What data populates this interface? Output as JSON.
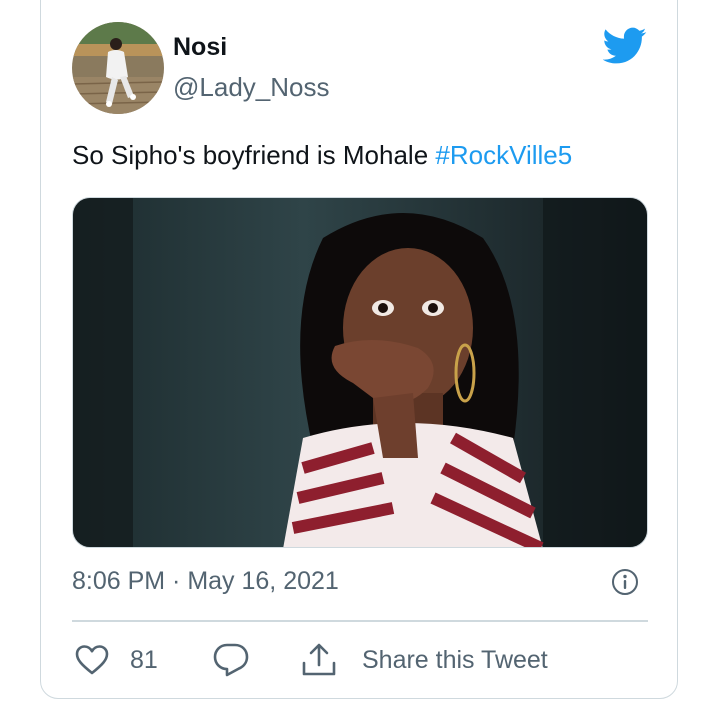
{
  "author": {
    "name": "Nosi",
    "handle": "@Lady_Noss"
  },
  "tweet": {
    "text": "So Sipho's boyfriend is Mohale ",
    "hashtag": "#RockVille5",
    "timestamp": "8:06 PM · May 16, 2021"
  },
  "actions": {
    "likes": "81",
    "share_label": "Share this Tweet"
  },
  "colors": {
    "accent": "#1d9bf0",
    "secondary_text": "#536471",
    "border": "#cfd9de"
  },
  "icons": [
    "twitter-bird-icon",
    "info-icon",
    "heart-icon",
    "reply-icon",
    "share-icon"
  ]
}
